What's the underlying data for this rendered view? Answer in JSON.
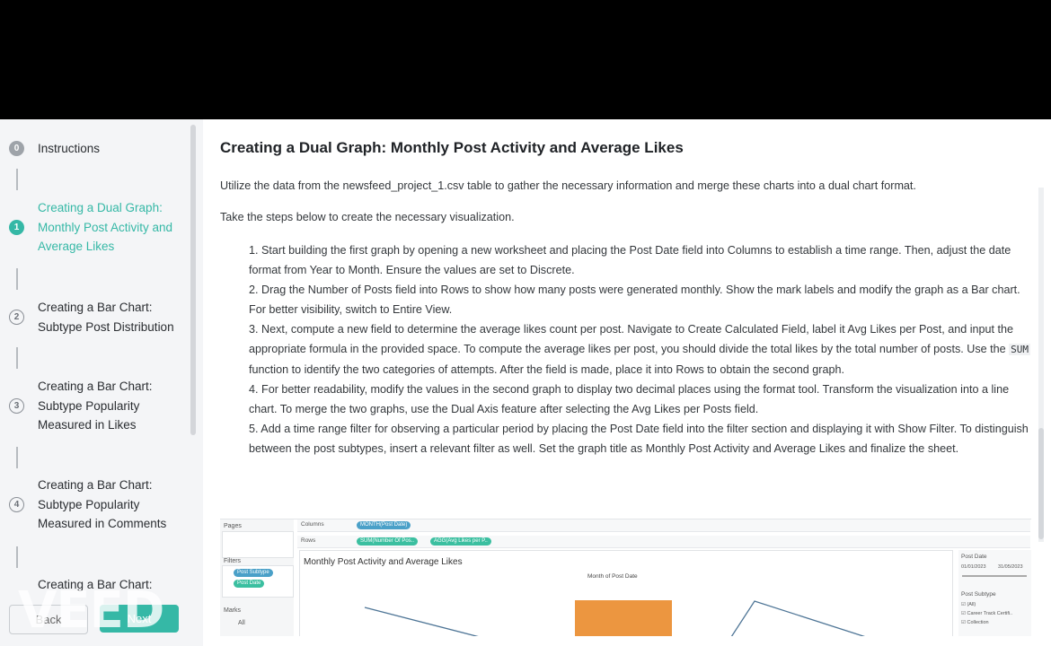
{
  "sidebar": {
    "steps": [
      {
        "num": "0",
        "label": "Instructions"
      },
      {
        "num": "1",
        "label": "Creating a Dual Graph: Monthly Post Activity and Average Likes"
      },
      {
        "num": "2",
        "label": "Creating a Bar Chart: Subtype Post Distribution"
      },
      {
        "num": "3",
        "label": "Creating a Bar Chart: Subtype Popularity Measured in Likes"
      },
      {
        "num": "4",
        "label": "Creating a Bar Chart: Subtype Popularity Measured in Comments"
      },
      {
        "num": "5",
        "label": "Creating a Bar Chart:"
      }
    ],
    "back_label": "Back",
    "next_label": "Next"
  },
  "main": {
    "title": "Creating a Dual Graph: Monthly Post Activity and Average Likes",
    "intro": "Utilize the data from the newsfeed_project_1.csv table to gather the necessary information and merge these charts into a dual chart format.",
    "lead": "Take the steps below to create the necessary visualization.",
    "step1": "1. Start building the first graph by opening a new worksheet and placing the Post Date field into Columns to establish a time range. Then, adjust the date format from Year to Month. Ensure the values are set to Discrete.",
    "step2": "2. Drag the Number of Posts field into Rows to show how many posts were generated monthly. Show the mark labels and modify the graph as a Bar chart. For better visibility, switch to Entire View.",
    "step3a": "3. Next, compute a new field to determine the average likes count per post. Navigate to Create Calculated Field, label it Avg Likes per Post, and input the appropriate formula in the provided space. To compute the average likes per post, you should divide the total likes by the total number of posts. Use the ",
    "step3code": "SUM",
    "step3b": " function to identify the two categories of attempts. After the field is made, place it into Rows to obtain the second graph.",
    "step4": "4. For better readability, modify the values in the second graph to display two decimal places using the format tool. Transform the visualization into a line chart. To merge the two graphs, use the Dual Axis feature after selecting the Avg Likes per Posts field.",
    "step5": "5. Add a time range filter for observing a particular period by placing the Post Date field into the filter section and displaying it with Show Filter. To distinguish between the post subtypes, insert a relevant filter as well. Set the graph title as Monthly Post Activity and Average Likes and finalize the sheet."
  },
  "tableau": {
    "pages_label": "Pages",
    "filters_label": "Filters",
    "filter_pills": [
      "Post Subtype",
      "Post Date"
    ],
    "marks_label": "Marks",
    "marks_value": "All",
    "columns_label": "Columns",
    "columns_pill": "MONTH(Post Date)",
    "rows_label": "Rows",
    "rows_pills": [
      "SUM(Number Of Pos..",
      "AGG(Avg Likes per P.."
    ],
    "view_title": "Monthly Post Activity and Average Likes",
    "axis_label": "Month of Post Date",
    "right_date_label": "Post Date",
    "date_from": "01/01/2023",
    "date_to": "31/05/2023",
    "right_subtype_label": "Post Subtype",
    "subtype_options": [
      "(All)",
      "Career Track Certifi..",
      "Collection"
    ],
    "bar_color": "#ec9640",
    "line_color": "#4e7596"
  },
  "watermark": "VEED",
  "colors": {
    "accent": "#35b8a6"
  }
}
